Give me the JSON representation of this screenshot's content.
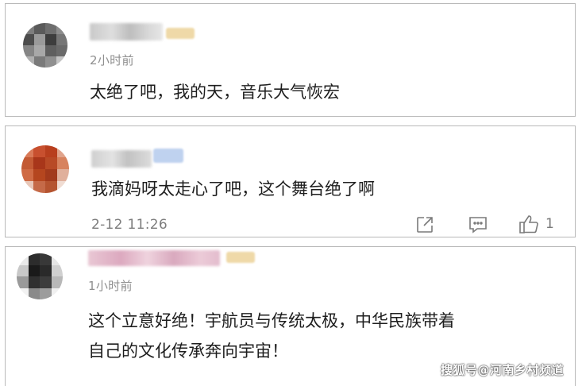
{
  "comments": [
    {
      "time": "2小时前",
      "content": "太绝了吧，我的天，音乐大气恢宏",
      "avatar_colors": [
        "#7d7d7d",
        "#5a5a5a",
        "#6e6e6e",
        "#8d8d8d",
        "#4c4c4c",
        "#9a9a9a",
        "#3d3d3d",
        "#767676",
        "#858585",
        "#a8a8a8",
        "#5f5f5f",
        "#6a6a6a",
        "#b0b0b0",
        "#7a7a7a",
        "#909090",
        "#c4c4c4"
      ]
    },
    {
      "time": "2-12 11:26",
      "content": "我滴妈呀太走心了吧，这个舞台绝了啊",
      "avatar_colors": [
        "#d97a58",
        "#c8502f",
        "#b83f1e",
        "#e0a48c",
        "#c35a34",
        "#a8361a",
        "#b84a26",
        "#d7835f",
        "#cf6a44",
        "#b5461f",
        "#a23a1c",
        "#e0b09c",
        "#e8c7b8",
        "#c56a48",
        "#b55430",
        "#f0dcd2"
      ],
      "like_count": "1"
    },
    {
      "time": "1小时前",
      "content_lines": [
        "这个立意好绝！宇航员与传统太极，中华民族带着",
        "自己的文化传承奔向宇宙！"
      ],
      "avatar_colors": [
        "#e9e9e9",
        "#2c2c2c",
        "#383838",
        "#e6e6e6",
        "#c8c8c8",
        "#1a1a1a",
        "#2a2a2a",
        "#d0d0d0",
        "#9a9a9a",
        "#303030",
        "#3c3c3c",
        "#b8b8b8",
        "#f2f2f2",
        "#8a8a8a",
        "#9c9c9c",
        "#f0f0f0"
      ]
    }
  ],
  "watermark": "搜狐号@河南乡村频道",
  "colors": {
    "card_border": "#b9b9b9",
    "time_text": "#8f8f8f",
    "content_text": "#1e1e1e",
    "icon": "#7a7a7a"
  },
  "icons": [
    "share-icon",
    "comment-icon",
    "like-icon"
  ]
}
